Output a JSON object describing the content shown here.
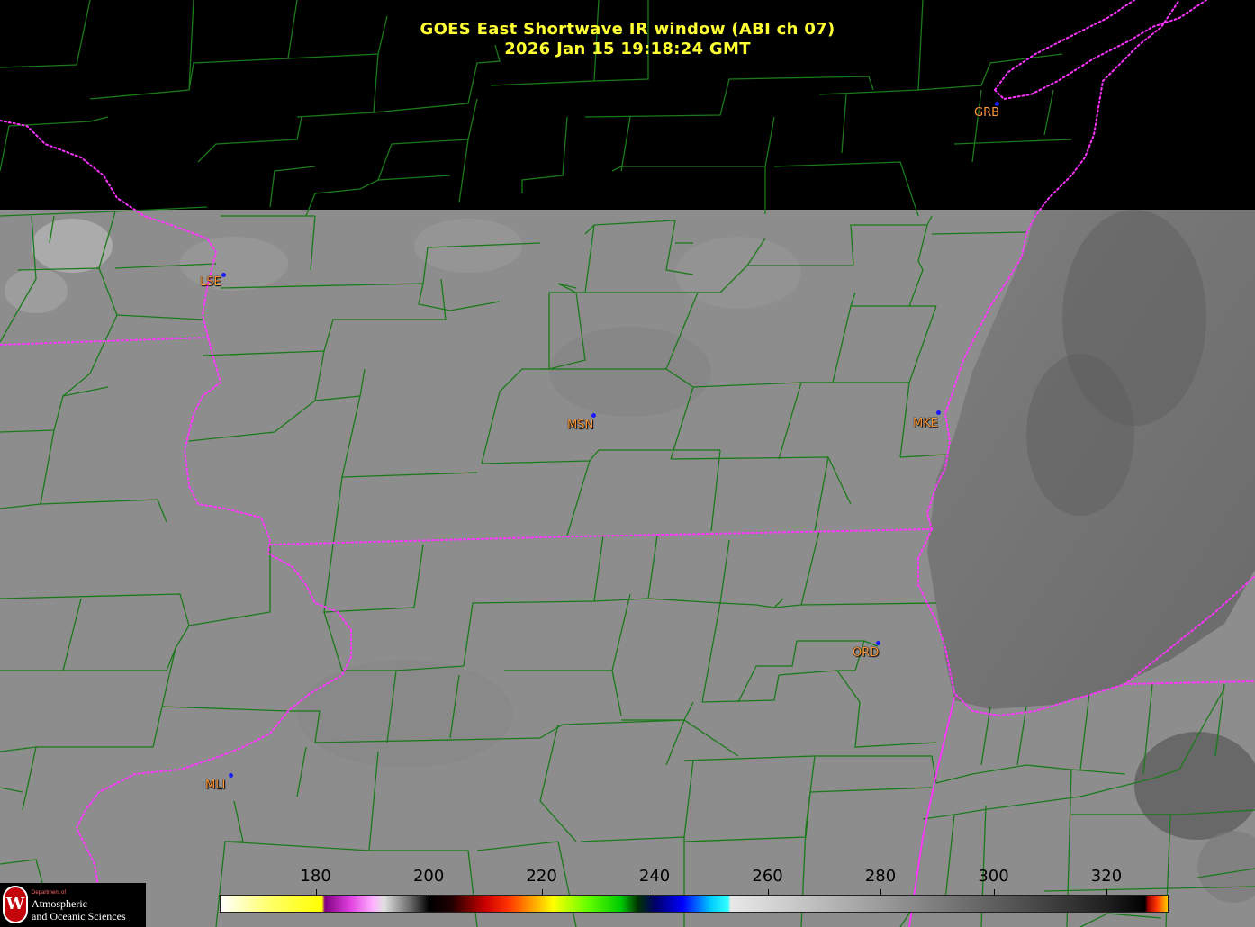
{
  "title": {
    "line1": "GOES East Shortwave IR window (ABI ch 07)",
    "line2": "2026 Jan 15  19:18:24 GMT"
  },
  "stations": [
    {
      "id": "GRB",
      "label": "GRB"
    },
    {
      "id": "LSE",
      "label": "LSE"
    },
    {
      "id": "MSN",
      "label": "MSN"
    },
    {
      "id": "MKE",
      "label": "MKE"
    },
    {
      "id": "ORD",
      "label": "ORD"
    },
    {
      "id": "MLI",
      "label": "MLI"
    }
  ],
  "colorbar": {
    "ticks": [
      "180",
      "200",
      "220",
      "240",
      "260",
      "280",
      "300",
      "320"
    ],
    "range": [
      163,
      331
    ],
    "stops": [
      {
        "t": 163,
        "c": "#ffffff"
      },
      {
        "t": 172,
        "c": "#ffff66"
      },
      {
        "t": 181,
        "c": "#ffff00"
      },
      {
        "t": 181.5,
        "c": "#800080"
      },
      {
        "t": 186,
        "c": "#e040e0"
      },
      {
        "t": 190,
        "c": "#ffb0ff"
      },
      {
        "t": 192,
        "c": "#e0e0e0"
      },
      {
        "t": 197,
        "c": "#606060"
      },
      {
        "t": 200,
        "c": "#000000"
      },
      {
        "t": 204,
        "c": "#200000"
      },
      {
        "t": 210,
        "c": "#cc0000"
      },
      {
        "t": 214,
        "c": "#ff3300"
      },
      {
        "t": 218,
        "c": "#ff9900"
      },
      {
        "t": 222,
        "c": "#ffff00"
      },
      {
        "t": 228,
        "c": "#66ff00"
      },
      {
        "t": 234,
        "c": "#00cc00"
      },
      {
        "t": 237,
        "c": "#003300"
      },
      {
        "t": 240,
        "c": "#000066"
      },
      {
        "t": 245,
        "c": "#0000ff"
      },
      {
        "t": 250,
        "c": "#00ccff"
      },
      {
        "t": 253,
        "c": "#33ffff"
      },
      {
        "t": 253.5,
        "c": "#e8e8e8"
      },
      {
        "t": 265,
        "c": "#c8c8c8"
      },
      {
        "t": 285,
        "c": "#8c8c8c"
      },
      {
        "t": 305,
        "c": "#505050"
      },
      {
        "t": 320,
        "c": "#202020"
      },
      {
        "t": 327,
        "c": "#000000"
      },
      {
        "t": 327.5,
        "c": "#990000"
      },
      {
        "t": 329,
        "c": "#ff3300"
      },
      {
        "t": 331,
        "c": "#ffcc00"
      }
    ]
  },
  "logo": {
    "seal": "W",
    "dept": "Department of",
    "line1": "Atmospheric",
    "line2": "and Oceanic Sciences"
  },
  "colors": {
    "county_lines": "#1a7a1a",
    "state_lines": "#ff33ff",
    "title": "#ffff33",
    "station_label": "#ff9a3c",
    "station_dot": "#1a1aff",
    "no_data": "#000000"
  }
}
